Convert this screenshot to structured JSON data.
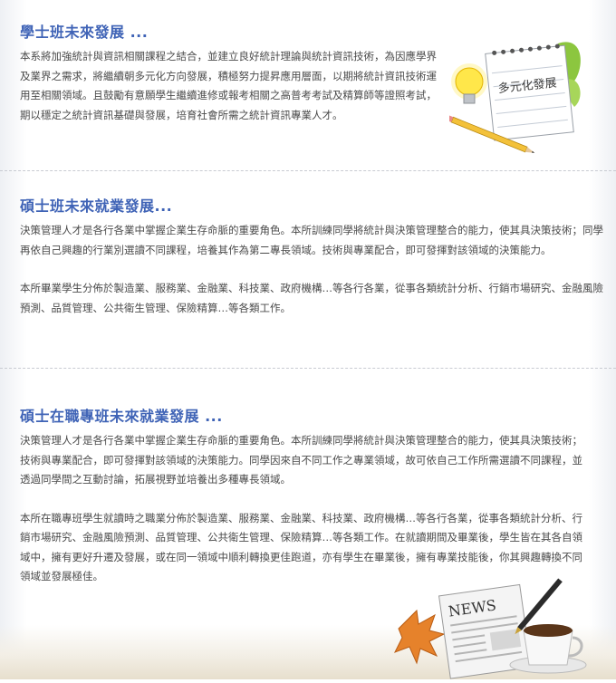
{
  "sections": [
    {
      "title": "學士班未來發展 ...",
      "paragraphs": [
        "本系將加強統計與資訊相關課程之結合，並建立良好統計理論與統計資訊技術，為因應學界及業界之需求，將繼續朝多元化方向發展，積極努力提昇應用層面，以期將統計資訊技術運用至相關領域。且鼓勵有意願學生繼續進修或報考相關之高普考考試及精算師等證照考試，期以穩定之統計資訊基礎與發展，培育社會所需之統計資訊專業人才。"
      ]
    },
    {
      "title": "碩士班未來就業發展...",
      "paragraphs": [
        "決策管理人才是各行各業中掌握企業生存命脈的重要角色。本所訓練同學將統計與決策管理整合的能力，使其具決策技術；同學再依自己興趣的行業別選讀不同課程，培養其作為第二專長領域。技術與專業配合，即可發揮對該領域的決策能力。",
        "本所畢業學生分佈於製造業、服務業、金融業、科技業、政府機構…等各行各業，從事各類統計分析、行銷市場研究、金融風險預測、品質管理、公共衛生管理、保險精算…等各類工作。"
      ]
    },
    {
      "title": "碩士在職專班未來就業發展 ...",
      "paragraphs": [
        "決策管理人才是各行各業中掌握企業生存命脈的重要角色。本所訓練同學將統計與決策管理整合的能力，使其具決策技術；技術與專業配合，即可發揮對該領域的決策能力。同學因來自不同工作之專業領域，故可依自己工作所需選讀不同課程，並透過同學間之互動討論，拓展視野並培養出多種專長領域。",
        "本所在職專班學生就讀時之職業分佈於製造業、服務業、金融業、科技業、政府機構…等各行各業，從事各類統計分析、行銷市場研究、金融風險預測、品質管理、公共衛生管理、保險精算…等各類工作。在就讀期間及畢業後，學生皆在其各自領域中，擁有更好升遷及發展，或在同一領域中順利轉換更佳跑道，亦有學生在畢業後，擁有專業技能後，你其興趣轉換不同領域並發展極佳。"
      ]
    }
  ],
  "decorations": {
    "note_text": "多元化發展",
    "news_text": "NEWS"
  },
  "colors": {
    "heading": "#3f63b6",
    "body_text": "#4a4a4a",
    "divider": "#c8cbd2"
  }
}
